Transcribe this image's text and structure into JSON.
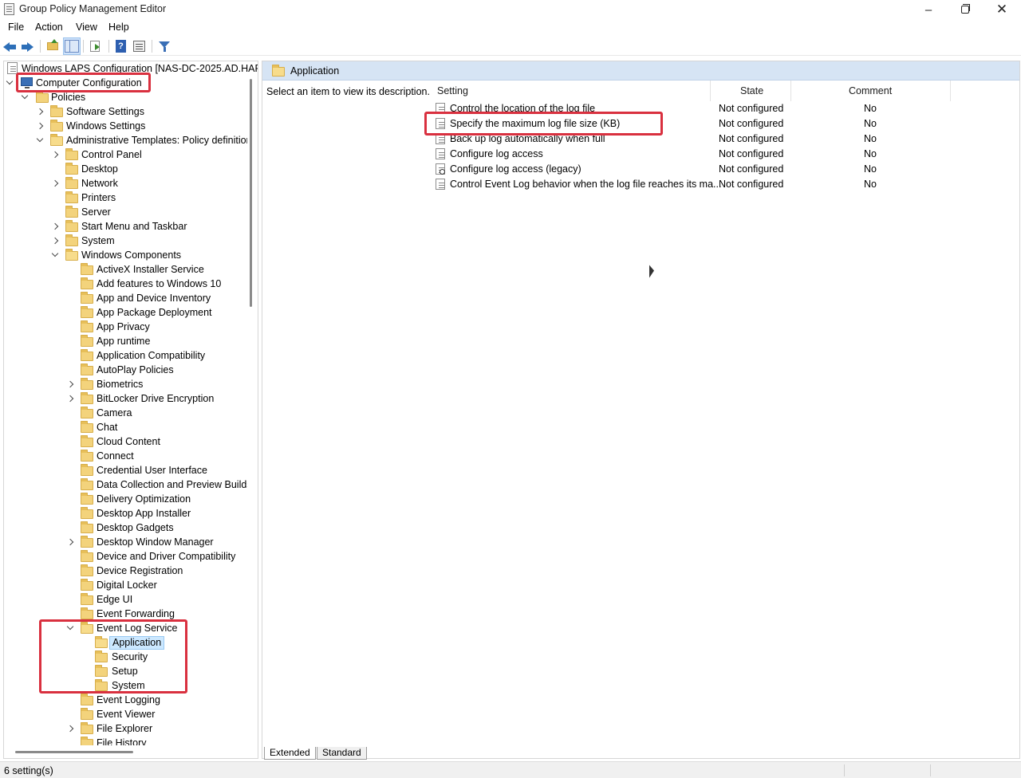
{
  "window": {
    "title": "Group Policy Management Editor"
  },
  "menubar": {
    "items": [
      "File",
      "Action",
      "View",
      "Help"
    ]
  },
  "toolbar": {
    "buttons": [
      "back-icon",
      "forward-icon",
      "up-folder-icon",
      "show-hide-tree-icon",
      "export-list-icon",
      "help-icon",
      "properties-icon",
      "filter-icon"
    ]
  },
  "tree": {
    "root_label": "Windows LAPS Configuration [NAS-DC-2025.AD.HAF",
    "computer_config": "Computer Configuration",
    "policies": "Policies",
    "software_settings": "Software Settings",
    "windows_settings": "Windows Settings",
    "admin_templates": "Administrative Templates: Policy definitions",
    "admin_children": [
      "Control Panel",
      "Desktop",
      "Network",
      "Printers",
      "Server",
      "Start Menu and Taskbar",
      "System",
      "Windows Components"
    ],
    "windows_components": [
      "ActiveX Installer Service",
      "Add features to Windows 10",
      "App and Device Inventory",
      "App Package Deployment",
      "App Privacy",
      "App runtime",
      "Application Compatibility",
      "AutoPlay Policies",
      "Biometrics",
      "BitLocker Drive Encryption",
      "Camera",
      "Chat",
      "Cloud Content",
      "Connect",
      "Credential User Interface",
      "Data Collection and Preview Builds",
      "Delivery Optimization",
      "Desktop App Installer",
      "Desktop Gadgets",
      "Desktop Window Manager",
      "Device and Driver Compatibility",
      "Device Registration",
      "Digital Locker",
      "Edge UI",
      "Event Forwarding",
      "Event Log Service"
    ],
    "event_log_children": [
      "Application",
      "Security",
      "Setup",
      "System"
    ],
    "after_event_log": [
      "Event Logging",
      "Event Viewer",
      "File Explorer",
      "File History"
    ]
  },
  "details": {
    "header_title": "Application",
    "description": "Select an item to view its description.",
    "columns": {
      "setting": "Setting",
      "state": "State",
      "comment": "Comment"
    },
    "rows": [
      {
        "name": "Control the location of the log file",
        "state": "Not configured",
        "comment": "No"
      },
      {
        "name": "Specify the maximum log file size (KB)",
        "state": "Not configured",
        "comment": "No"
      },
      {
        "name": "Back up log automatically when full",
        "state": "Not configured",
        "comment": "No"
      },
      {
        "name": "Configure log access",
        "state": "Not configured",
        "comment": "No"
      },
      {
        "name": "Configure log access (legacy)",
        "state": "Not configured",
        "comment": "No"
      },
      {
        "name": "Control Event Log behavior when the log file reaches its ma...",
        "state": "Not configured",
        "comment": "No"
      }
    ],
    "tabs": [
      "Extended",
      "Standard"
    ]
  },
  "statusbar": {
    "text": "6 setting(s)"
  },
  "colors": {
    "highlight": "#d9303f",
    "header_bg": "#d6e4f4",
    "selection_bg": "#cce8ff"
  }
}
